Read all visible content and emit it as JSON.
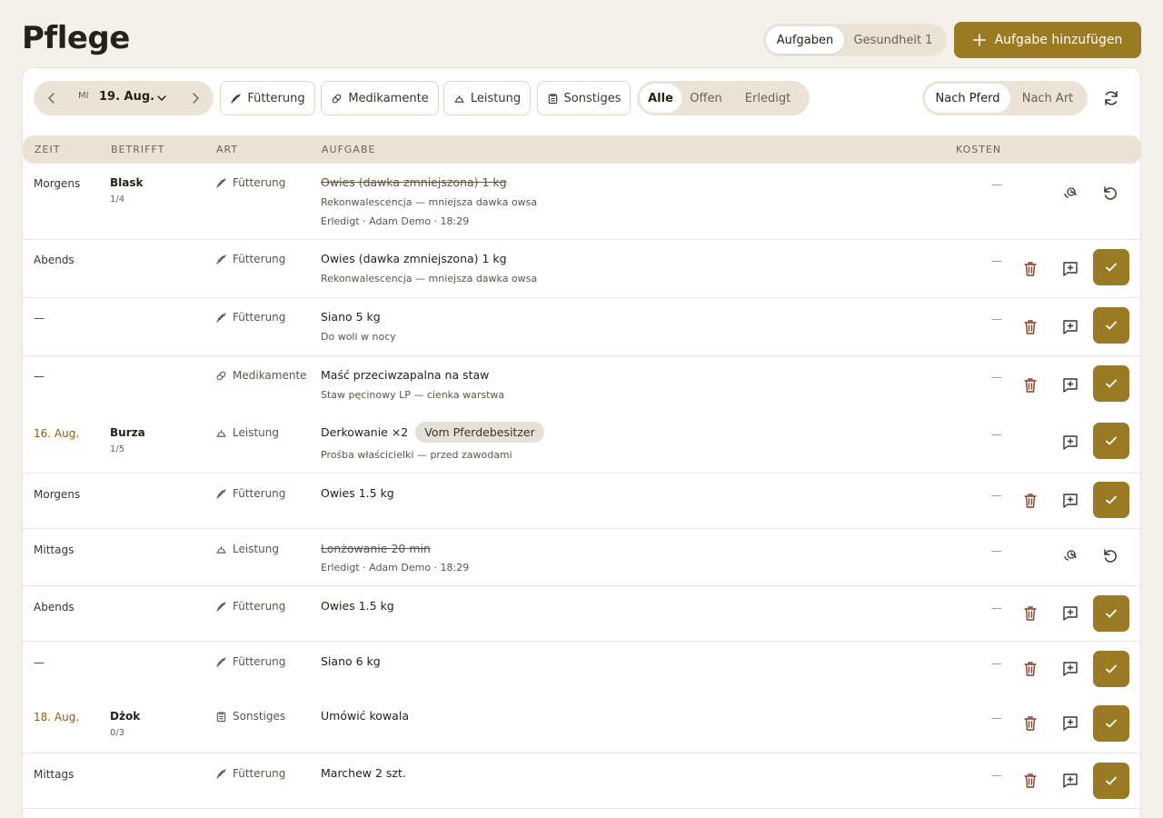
{
  "page": {
    "title": "Pflege"
  },
  "view_tabs": {
    "tasks": "Aufgaben",
    "health": "Gesundheit 1"
  },
  "add_button": "Aufgabe hinzufügen",
  "toolbar": {
    "day_of_week": "MI",
    "date": "19. Aug.",
    "filters": {
      "feeding": "Fütterung",
      "medication": "Medikamente",
      "service": "Leistung",
      "other": "Sonstiges"
    },
    "status": {
      "all": "Alle",
      "open": "Offen",
      "done": "Erledigt"
    },
    "grouping": {
      "by_horse": "Nach Pferd",
      "by_type": "Nach Art"
    }
  },
  "table": {
    "headers": {
      "time": "ZEIT",
      "horse": "BETRIFFT",
      "type": "ART",
      "task": "AUFGABE",
      "cost": "KOSTEN"
    },
    "rows": [
      {
        "time": "Morgens",
        "horse": "Blask",
        "count": "1/4",
        "type": "Fütterung",
        "task": "Owies (dawka zmniejszona) 1 kg",
        "note": "Rekonwalescencja — mniejsza dawka owsa",
        "status": "Erledigt · Adam Demo · 18:29",
        "cost": "—"
      },
      {
        "time": "Abends",
        "type": "Fütterung",
        "task": "Owies (dawka zmniejszona) 1 kg",
        "note": "Rekonwalescencja — mniejsza dawka owsa",
        "cost": "—"
      },
      {
        "time": "—",
        "type": "Fütterung",
        "task": "Siano 5 kg",
        "note": "Do woli w nocy",
        "cost": "—"
      },
      {
        "time": "—",
        "type": "Medikamente",
        "task": "Maść przeciwzapalna na staw",
        "note": "Staw pęcinowy LP — cienka warstwa",
        "cost": "—"
      },
      {
        "time": "16. Aug.",
        "horse": "Burza",
        "count": "1/5",
        "type": "Leistung",
        "task": "Derkowanie ×2",
        "badge": "Vom Pferdebesitzer",
        "note": "Prośba właścicielki — przed zawodami",
        "cost": "—"
      },
      {
        "time": "Morgens",
        "type": "Fütterung",
        "task": "Owies 1.5 kg",
        "cost": "—"
      },
      {
        "time": "Mittags",
        "type": "Leistung",
        "task": "Lonżowanie 20 min",
        "status": "Erledigt · Adam Demo · 18:29",
        "cost": "—"
      },
      {
        "time": "Abends",
        "type": "Fütterung",
        "task": "Owies 1.5 kg",
        "cost": "—"
      },
      {
        "time": "—",
        "type": "Fütterung",
        "task": "Siano 6 kg",
        "cost": "—"
      },
      {
        "time": "18. Aug.",
        "horse": "Dżok",
        "count": "0/3",
        "type": "Sonstiges",
        "task": "Umówić kowala",
        "cost": "—"
      },
      {
        "time": "Mittags",
        "type": "Fütterung",
        "task": "Marchew 2 szt.",
        "cost": "—"
      }
    ]
  },
  "colors": {
    "accent": "#9a7a23",
    "background": "#f4f1eb",
    "pill": "#ebe3d5",
    "delete": "#8a3d2a",
    "date": "#8a5a14"
  },
  "icons": [
    "chevron-left-icon",
    "chevron-right-icon",
    "chevron-down-icon",
    "wheat-icon",
    "pill-icon",
    "bell-icon",
    "clipboard-icon",
    "refresh-icon",
    "trash-icon",
    "comment-plus-icon",
    "check-icon",
    "history-icon",
    "undo-icon",
    "plus-icon"
  ]
}
